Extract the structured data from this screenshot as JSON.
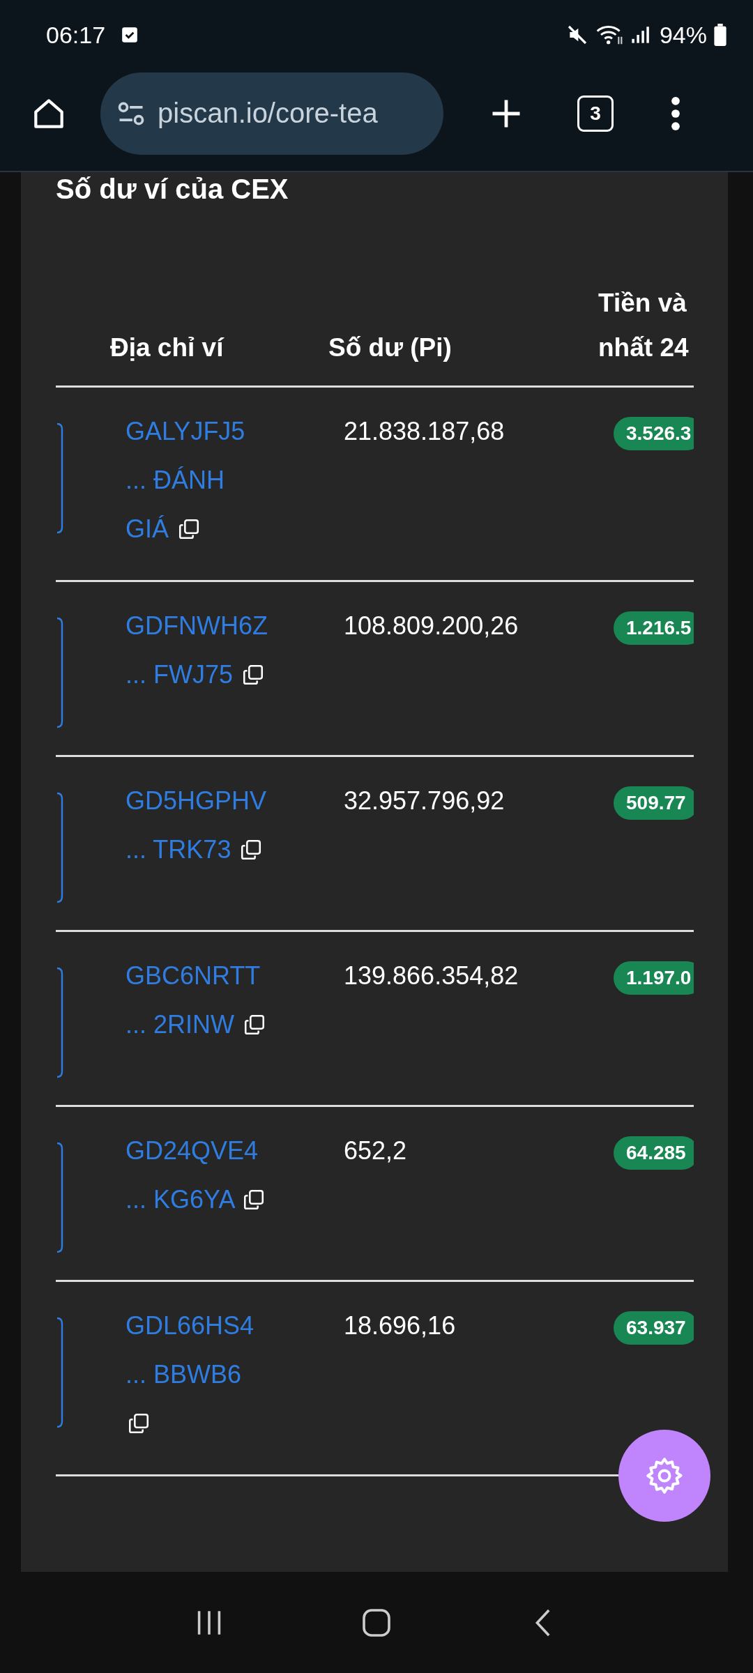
{
  "status_bar": {
    "time": "06:17",
    "battery": "94%"
  },
  "browser": {
    "url": "piscan.io/core-tea",
    "tab_count": "3"
  },
  "page_title": "Số dư ví của CEX",
  "table": {
    "columns": [
      "Địa chỉ ví",
      "Số dư (Pi)",
      "Tiền và nhất 24"
    ],
    "rows": [
      {
        "address_head": "GALYJFJ5",
        "address_tail": "... ĐÁNH GIÁ",
        "balance": "21.838.187,68",
        "change": "3.526.3"
      },
      {
        "address_head": "GDFNWH6Z",
        "address_tail": "... FWJ75",
        "balance": "108.809.200,26",
        "change": "1.216.5"
      },
      {
        "address_head": "GD5HGPHV",
        "address_tail": "... TRK73",
        "balance": "32.957.796,92",
        "change": "509.77"
      },
      {
        "address_head": "GBC6NRTT",
        "address_tail": "... 2RINW",
        "balance": "139.866.354,82",
        "change": "1.197.0"
      },
      {
        "address_head": "GD24QVE4",
        "address_tail": "... KG6YA",
        "balance": "652,2",
        "change": "64.285"
      },
      {
        "address_head": "GDL66HS4",
        "address_tail": "... BBWB6",
        "balance": "18.696,16",
        "change": "63.937"
      }
    ]
  }
}
